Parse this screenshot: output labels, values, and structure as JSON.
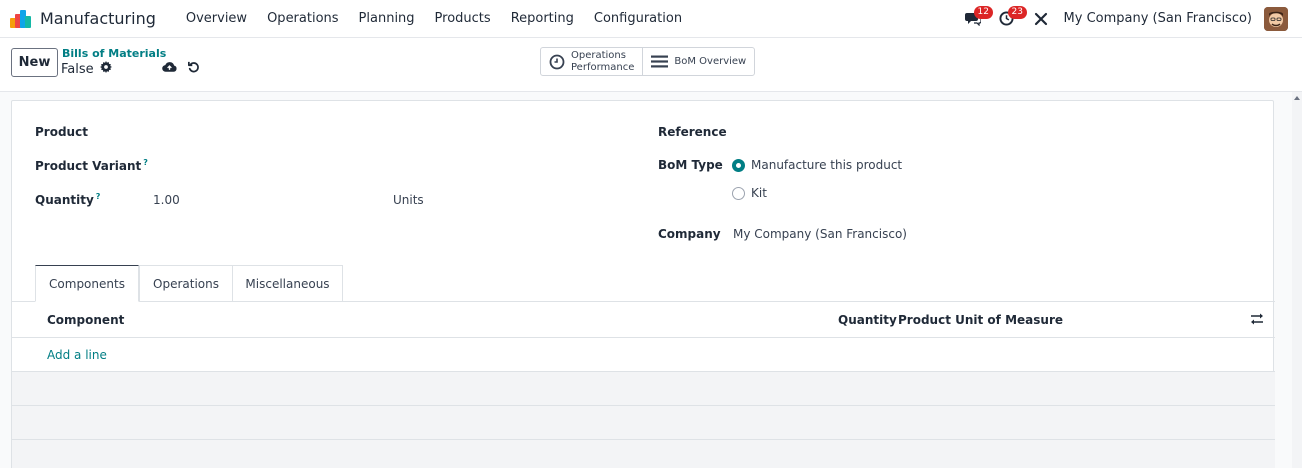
{
  "app": {
    "title": "Manufacturing",
    "menu": [
      "Overview",
      "Operations",
      "Planning",
      "Products",
      "Reporting",
      "Configuration"
    ]
  },
  "systray": {
    "messages_count": "12",
    "activities_count": "23",
    "company": "My Company (San Francisco)"
  },
  "control_panel": {
    "new_label": "New",
    "breadcrumb_parent": "Bills of Materials",
    "breadcrumb_current": "False",
    "smart_buttons": {
      "operations_performance_line1": "Operations",
      "operations_performance_line2": "Performance",
      "bom_overview": "BoM Overview"
    }
  },
  "form": {
    "product_label": "Product",
    "product_variant_label": "Product Variant",
    "quantity_label": "Quantity",
    "quantity_value": "1.00",
    "uom_value": "Units",
    "reference_label": "Reference",
    "bom_type_label": "BoM Type",
    "bom_type_options": [
      "Manufacture this product",
      "Kit"
    ],
    "bom_type_selected": "Manufacture this product",
    "company_label": "Company",
    "company_value": "My Company (San Francisco)",
    "help_mark": "?"
  },
  "tabs": [
    "Components",
    "Operations",
    "Miscellaneous"
  ],
  "components_table": {
    "headers": {
      "component": "Component",
      "quantity": "Quantity",
      "uom": "Product Unit of Measure"
    },
    "add_line": "Add a line"
  },
  "colors": {
    "accent": "#017e84",
    "badge": "#dc2626"
  }
}
